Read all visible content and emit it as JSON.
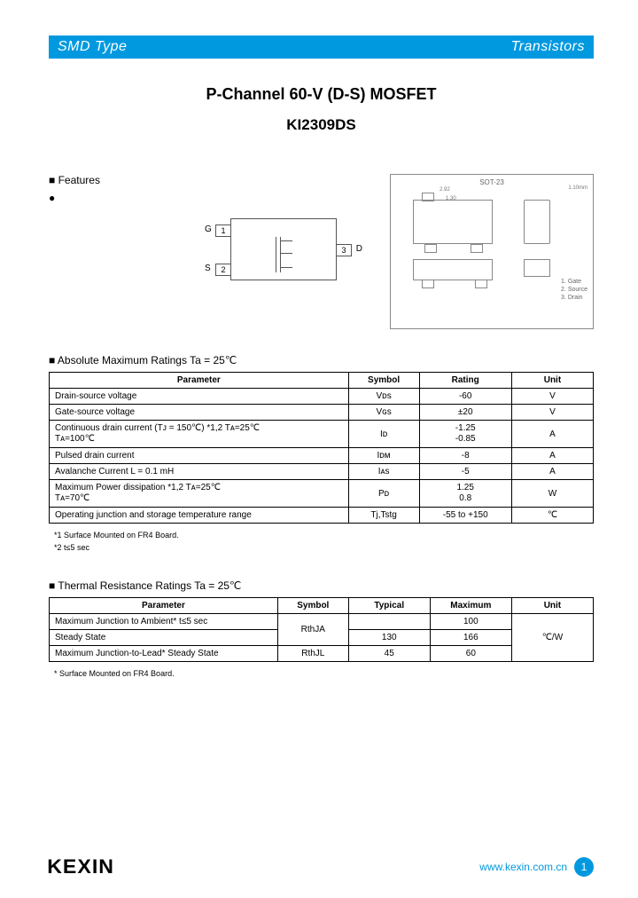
{
  "banner": {
    "left": "SMD Type",
    "right": "Transistors"
  },
  "title": {
    "line1": "P-Channel 60-V (D-S) MOSFET",
    "line2": "KI2309DS"
  },
  "features": {
    "heading": "Features",
    "bullet": ""
  },
  "pins": {
    "g": "G",
    "s": "S",
    "d": "D",
    "n1": "1",
    "n2": "2",
    "n3": "3"
  },
  "package": {
    "title": "SOT-23",
    "dim1": "2.92",
    "dim2": "1.30",
    "right": "1.10mm",
    "notes": "1. Gate\n2. Source\n3. Drain"
  },
  "abs": {
    "heading": "Absolute Maximum Ratings Ta = 25℃",
    "cols": {
      "p": "Parameter",
      "s": "Symbol",
      "r": "Rating",
      "u": "Unit"
    },
    "rows": [
      {
        "p": "Drain-source voltage",
        "s": "Vᴅs",
        "r": "-60",
        "u": "V"
      },
      {
        "p": "Gate-source voltage",
        "s": "Vɢs",
        "r": "±20",
        "u": "V"
      },
      {
        "p": "Continuous drain current (Tᴊ = 150℃) *1,2   Tᴀ=25℃\n                                                               Tᴀ=100℃",
        "s": "Iᴅ",
        "r": "-1.25\n-0.85",
        "u": "A"
      },
      {
        "p": "Pulsed drain current",
        "s": "Iᴅᴍ",
        "r": "-8",
        "u": "A"
      },
      {
        "p": "Avalanche Current                              L = 0.1 mH",
        "s": "Iᴀs",
        "r": "-5",
        "u": "A"
      },
      {
        "p": "Maximum Power dissipation *1,2                       Tᴀ=25℃\n                                                               Tᴀ=70℃",
        "s": "Pᴅ",
        "r": "1.25\n0.8",
        "u": "W"
      },
      {
        "p": "Operating junction and storage temperature range",
        "s": "Tj,Tstg",
        "r": "-55 to +150",
        "u": "℃"
      }
    ],
    "notes": "*1 Surface Mounted on FR4 Board.\n*2 t≤5 sec"
  },
  "thermal": {
    "heading": "Thermal Resistance Ratings Ta = 25℃",
    "cols": {
      "p": "Parameter",
      "s": "Symbol",
      "t": "Typical",
      "m": "Maximum",
      "u": "Unit"
    },
    "rows": [
      {
        "p": "Maximum Junction to Ambient*           t≤5 sec",
        "s": "RthJA",
        "t": "",
        "m": "100",
        "u": "℃/W",
        "rs": 2
      },
      {
        "p": "                                                      Steady State",
        "t": "130",
        "m": "166"
      },
      {
        "p": "Maximum Junction-to-Lead*             Steady State",
        "s": "RthJL",
        "t": "45",
        "m": "60"
      }
    ],
    "notes": "* Surface Mounted on FR4 Board."
  },
  "footer": {
    "brand": "KEXIN",
    "url": "www.kexin.com.cn",
    "page": "1"
  }
}
